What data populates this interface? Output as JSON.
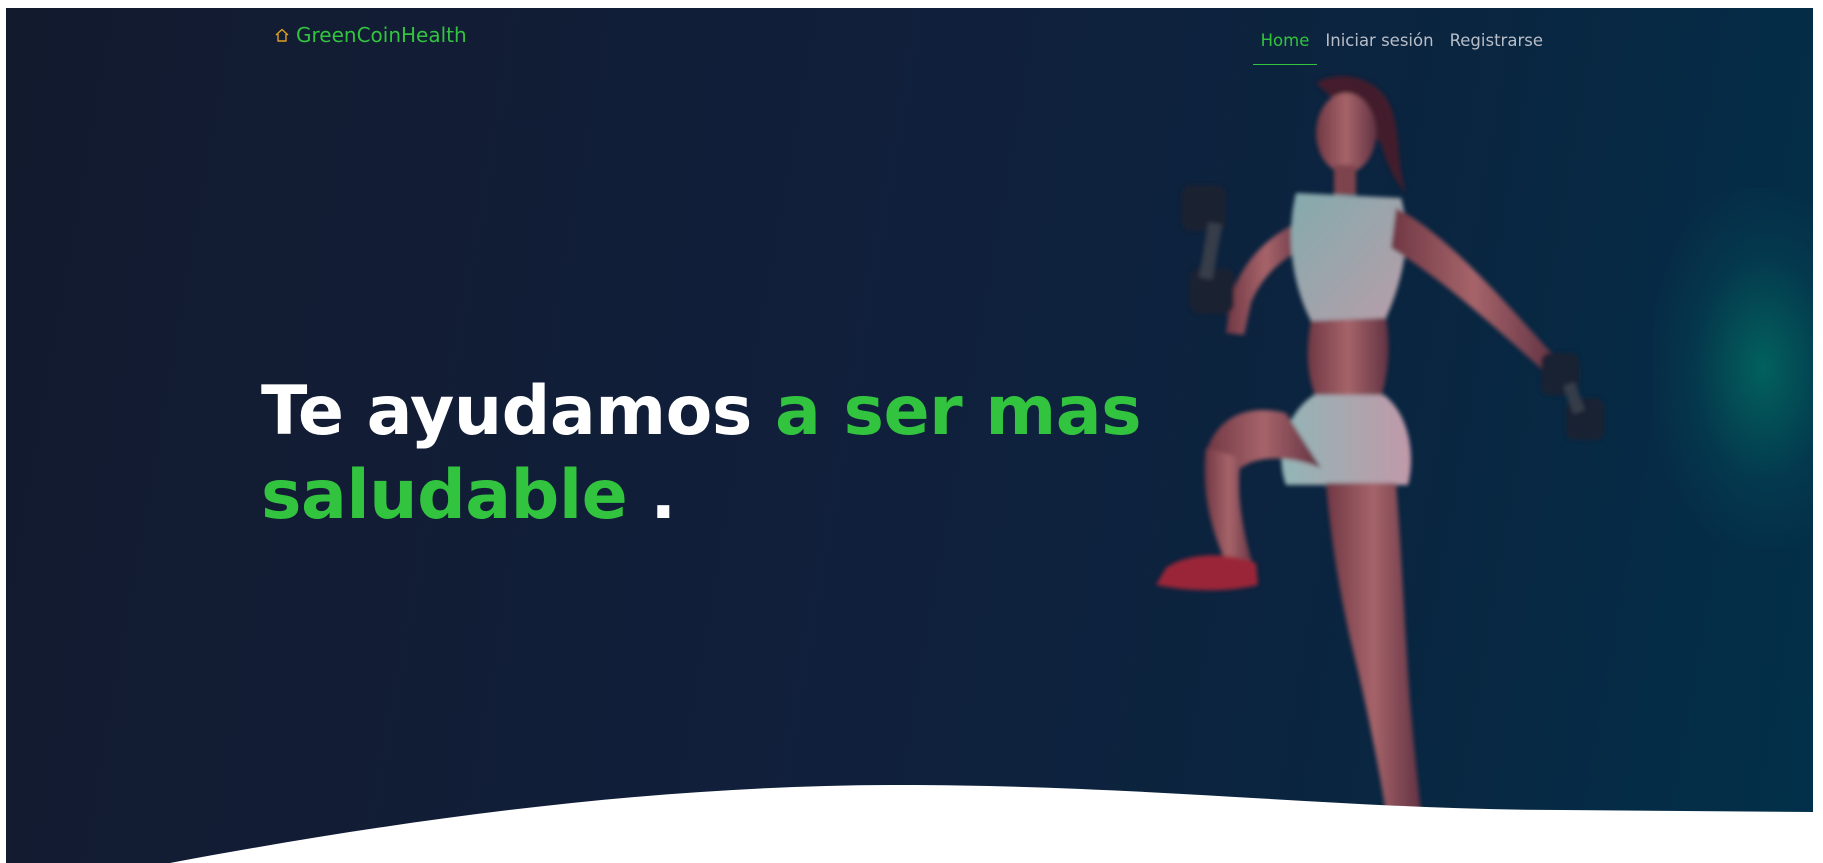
{
  "navbar": {
    "brand": "GreenCoinHealth",
    "brand_icon": "home-icon",
    "links": [
      {
        "label": "Home",
        "active": true
      },
      {
        "label": "Iniciar sesión",
        "active": false
      },
      {
        "label": "Registrarse",
        "active": false
      }
    ]
  },
  "hero": {
    "headline_part1": "Te ayudamos ",
    "headline_part2": "a ser mas saludable",
    "headline_part3": " .",
    "image": "athlete-with-dumbbells"
  },
  "colors": {
    "accent": "#32c43f",
    "brand_icon": "#e0a020",
    "background_dark": "#111f3b",
    "nav_text": "#b8bec8"
  }
}
